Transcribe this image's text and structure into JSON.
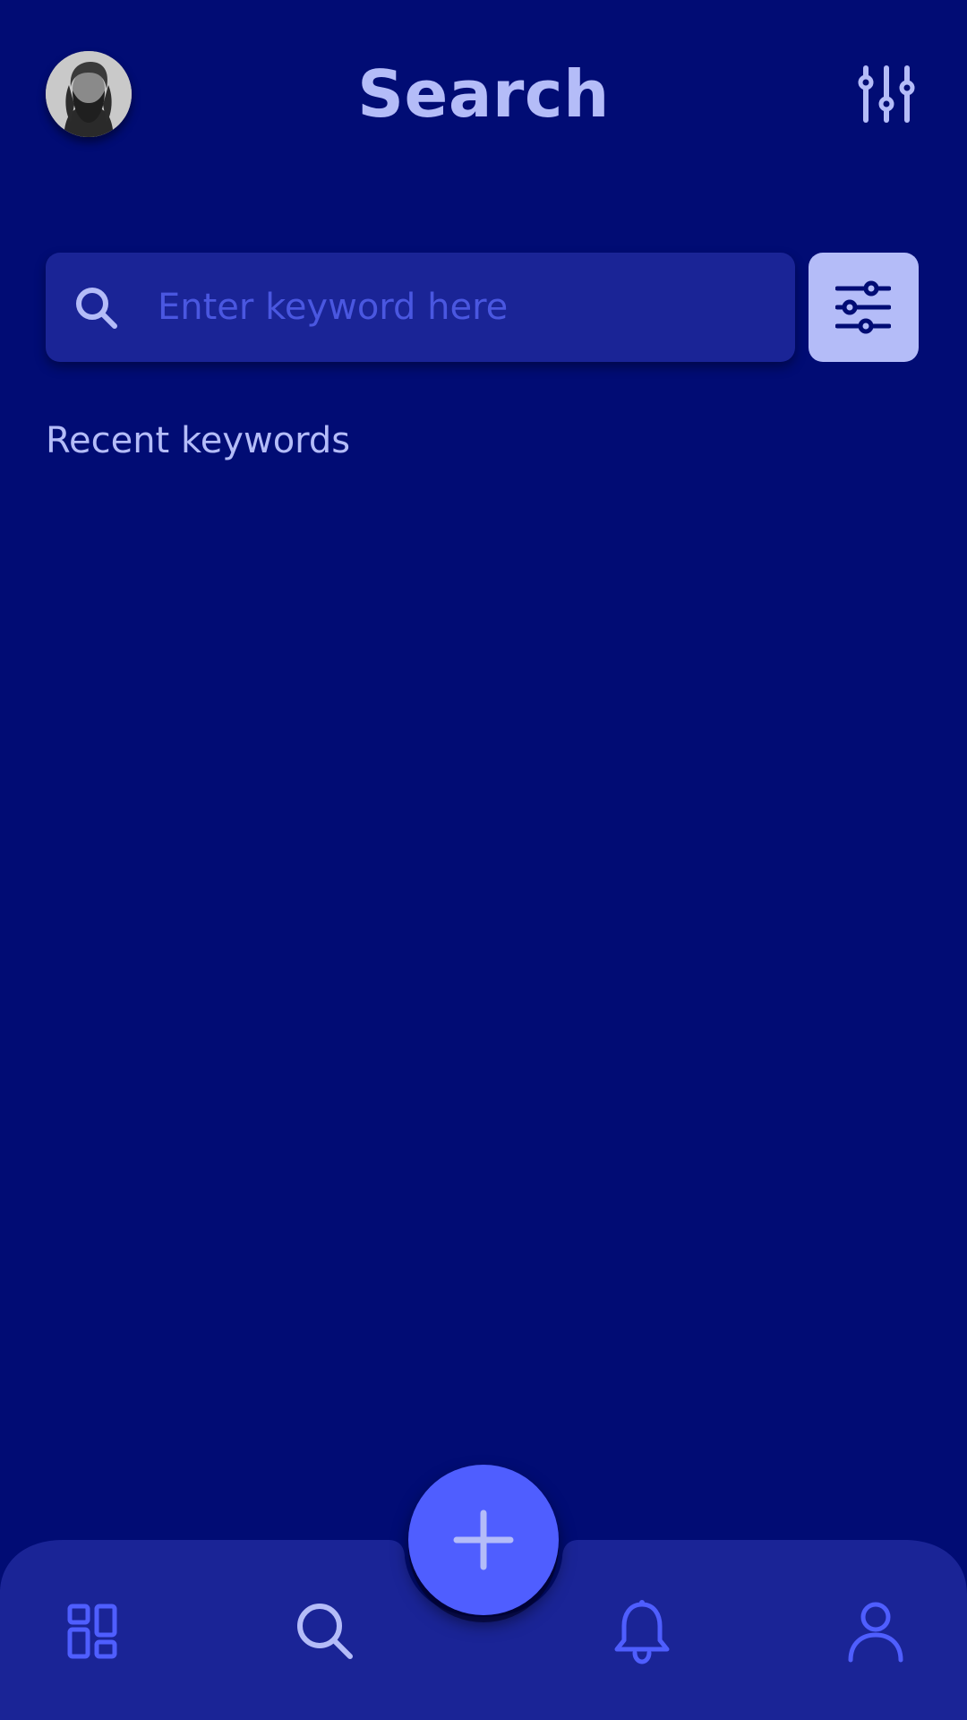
{
  "header": {
    "title": "Search",
    "avatar_icon": "user-avatar-photo",
    "settings_icon": "sliders-vertical-icon"
  },
  "search": {
    "placeholder": "Enter keyword here",
    "value": "",
    "icon": "search-icon",
    "filter_icon": "sliders-horizontal-icon"
  },
  "recent": {
    "label": "Recent keywords",
    "items": []
  },
  "bottom_nav": {
    "items": [
      {
        "icon": "dashboard-icon",
        "active": false
      },
      {
        "icon": "search-icon",
        "active": true
      },
      {
        "icon": "bell-icon",
        "active": false
      },
      {
        "icon": "profile-icon",
        "active": false
      }
    ],
    "fab_icon": "plus-icon"
  },
  "colors": {
    "background": "#010c74",
    "surface": "#1a2496",
    "accent": "#4f5eff",
    "light": "#b4bcf8",
    "placeholder": "#4a57e0"
  }
}
